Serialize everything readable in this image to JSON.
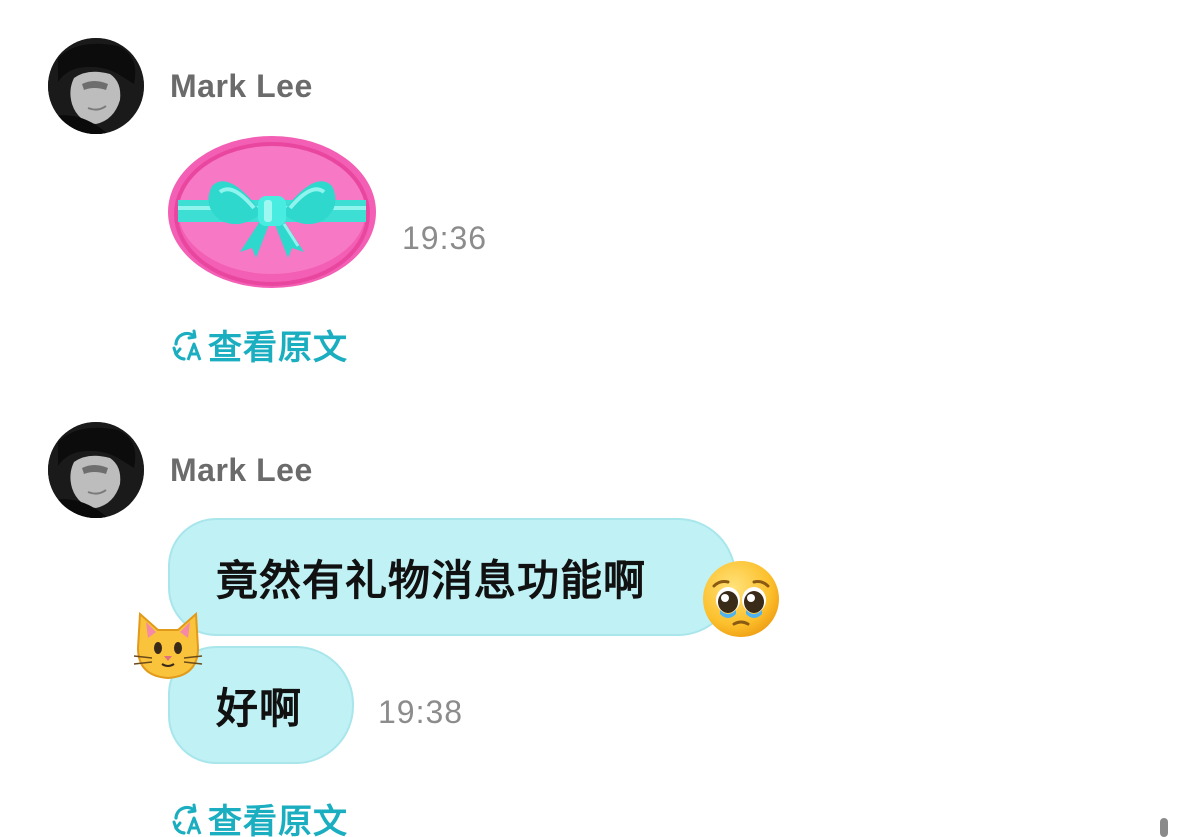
{
  "messages": [
    {
      "sender": "Mark Lee",
      "type": "gift",
      "sticker": "gift-bow-sticker",
      "time": "19:36",
      "translate_label": "查看原文"
    },
    {
      "sender": "Mark Lee",
      "type": "text",
      "bubbles": [
        {
          "text": "竟然有礼物消息功能啊",
          "reaction": "pleading-face-emoji"
        },
        {
          "text": "好啊",
          "reaction": "cat-face-emoji"
        }
      ],
      "time": "19:38",
      "translate_label": "查看原文"
    }
  ],
  "colors": {
    "bubble_fill": "#bff1f5",
    "bubble_border": "#a8e6ec",
    "link": "#1aaec0",
    "sender": "#6b6b6b",
    "time": "#8c8c8c",
    "gift_pink": "#f761b6",
    "gift_ribbon": "#3fe6dc"
  },
  "icons": {
    "translate": "translate-icon"
  }
}
